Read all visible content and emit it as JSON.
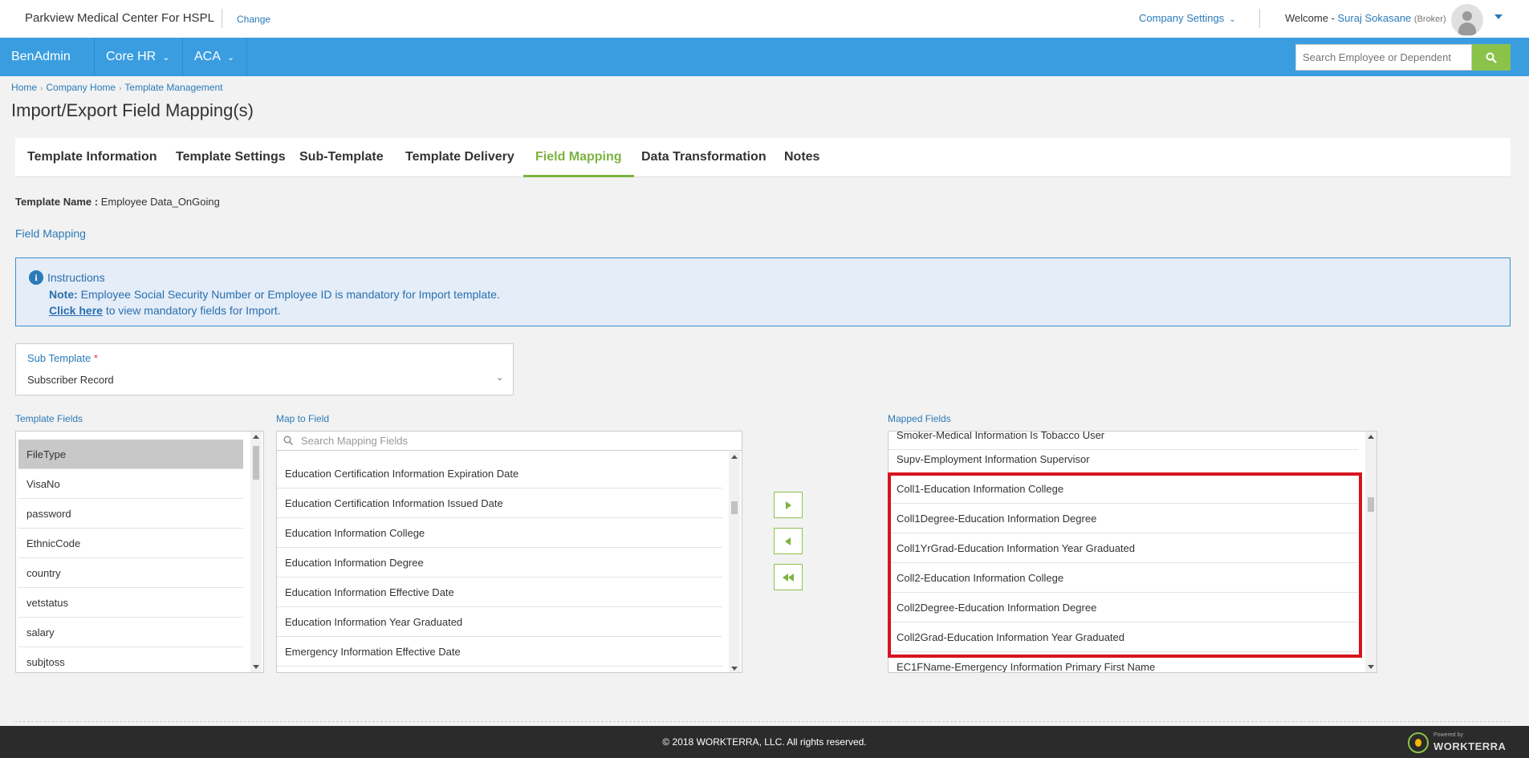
{
  "topbar": {
    "org_name": "Parkview Medical Center For HSPL",
    "change_label": "Change",
    "company_settings_label": "Company Settings",
    "welcome_prefix": "Welcome - ",
    "user_name": "Suraj Sokasane",
    "user_role": "(Broker)"
  },
  "nav": {
    "items": [
      {
        "label": "BenAdmin"
      },
      {
        "label": "Core HR"
      },
      {
        "label": "ACA"
      }
    ],
    "search_placeholder": "Search Employee or Dependent"
  },
  "breadcrumb": [
    "Home",
    "Company Home",
    "Template Management"
  ],
  "page_title": "Import/Export Field Mapping(s)",
  "tabs": [
    {
      "label": "Template Information"
    },
    {
      "label": "Template Settings"
    },
    {
      "label": "Sub-Template"
    },
    {
      "label": "Template Delivery"
    },
    {
      "label": "Field Mapping",
      "active": true
    },
    {
      "label": "Data Transformation"
    },
    {
      "label": "Notes"
    }
  ],
  "template_name": {
    "label": "Template Name :",
    "value": "Employee Data_OnGoing"
  },
  "field_mapping_label": "Field Mapping",
  "instructions": {
    "title": "Instructions",
    "note_label": "Note:",
    "note_text": "Employee Social Security Number or Employee ID is mandatory for Import template.",
    "click_link": "Click here",
    "click_text": "to view mandatory fields for Import."
  },
  "sub_template": {
    "label": "Sub Template",
    "required_mark": "*",
    "value": "Subscriber Record"
  },
  "template_fields": {
    "label": "Template Fields",
    "items": [
      "FileType",
      "VisaNo",
      "password",
      "EthnicCode",
      "country",
      "vetstatus",
      "salary",
      "subjtoss"
    ]
  },
  "map_to_field": {
    "label": "Map to Field",
    "search_placeholder": "Search Mapping Fields",
    "items": [
      "Education Certification Information Expiration Date",
      "Education Certification Information Issued Date",
      "Education Information College",
      "Education Information Degree",
      "Education Information Effective Date",
      "Education Information Year Graduated",
      "Emergency Information Effective Date"
    ]
  },
  "mapped_fields": {
    "label": "Mapped Fields",
    "top_partial": "Smoker-Medical Information Is Tobacco User",
    "items": [
      "Supv-Employment Information Supervisor",
      "Coll1-Education Information College",
      "Coll1Degree-Education Information Degree",
      "Coll1YrGrad-Education Information Year Graduated",
      "Coll2-Education Information College",
      "Coll2Degree-Education Information Degree",
      "Coll2Grad-Education Information Year Graduated"
    ],
    "bottom_partial": "EC1FName-Emergency Information Primary First Name"
  },
  "footer": {
    "copyright": "© 2018 WORKTERRA, LLC. All rights reserved.",
    "powered_by": "Powered by",
    "brand": "WORKTERRA"
  },
  "colors": {
    "nav_blue": "#3a9de0",
    "accent_green": "#8bc34a",
    "link_blue": "#2a7ab8",
    "highlight_red": "#d7141f"
  }
}
